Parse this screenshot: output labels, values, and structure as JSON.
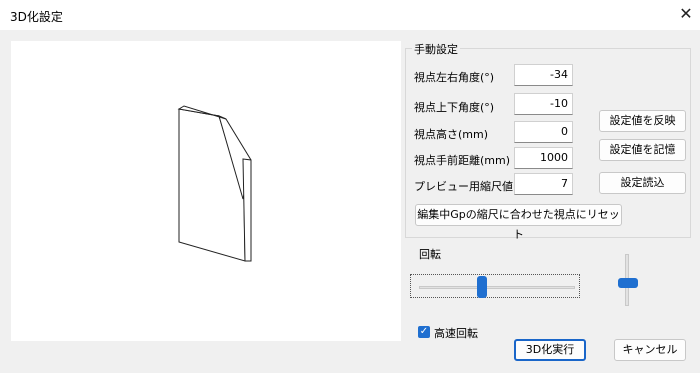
{
  "window": {
    "title": "3D化設定"
  },
  "manual": {
    "group_title": "手動設定",
    "fields": [
      {
        "label": "視点左右角度(°)",
        "value": "-34"
      },
      {
        "label": "視点上下角度(°)",
        "value": "-10"
      },
      {
        "label": "視点高さ(mm)",
        "value": "0"
      },
      {
        "label": "視点手前距離(mm)",
        "value": "1000"
      },
      {
        "label": "プレビュー用縮尺値",
        "value": "7"
      }
    ],
    "buttons": {
      "apply": "設定値を反映",
      "store": "設定値を記憶",
      "load": "設定読込",
      "reset": "編集中Gpの縮尺に合わせた視点にリセット"
    }
  },
  "rotation": {
    "label": "回転",
    "horizontal_level": 0.38,
    "vertical_level": 0.5
  },
  "fast_rotation": {
    "label": "高速回転",
    "checked": true
  },
  "footer": {
    "run": "3D化実行",
    "cancel": "キャンセル"
  },
  "colors": {
    "accent": "#1f6fd0",
    "background": "#f0f0f0"
  }
}
